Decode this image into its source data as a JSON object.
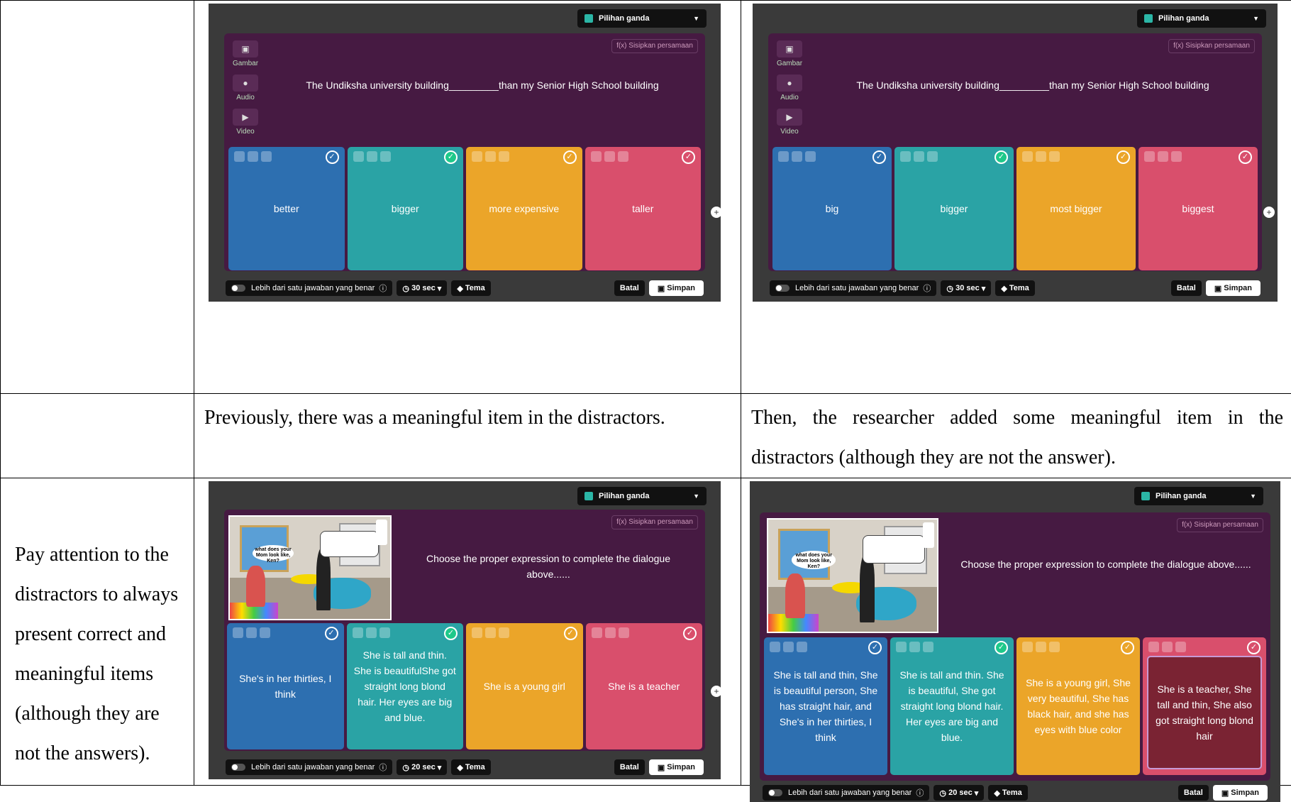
{
  "document": {
    "row2": {
      "left_text": "Previously, there was a meaningful item in the distractors.",
      "right_text": "Then, the researcher added some meaningful item in the distractors (although they are not the answer)."
    },
    "row3": {
      "label_text": "Pay attention to the distractors to always present correct and meaningful items (although they are not the answers)."
    }
  },
  "quiz_ui": {
    "type_selector": "Pilihan ganda",
    "equation_button": "f(x) Sisipkan persamaan",
    "media": [
      "Gambar",
      "Audio",
      "Video"
    ],
    "multiple_answers_toggle": "Lebih dari satu jawaban yang benar",
    "theme": "Tema",
    "cancel": "Batal",
    "save": "Simpan"
  },
  "screens": {
    "s1": {
      "question": "The Undiksha university building_________than my Senior High School building",
      "time": "30 sec",
      "options": [
        "better",
        "bigger",
        "more expensive",
        "taller"
      ],
      "correct_index": 1
    },
    "s2": {
      "question": "The Undiksha university building_________than my Senior High School building",
      "time": "30 sec",
      "options": [
        "big",
        "bigger",
        "most bigger",
        "biggest"
      ],
      "correct_index": 1
    },
    "s3": {
      "question": "Choose the proper expression to complete the dialogue above......",
      "bubble": "what does your Mom look like, Ken?",
      "time": "20 sec",
      "options": [
        "She's in her thirties, I think",
        "She is tall and thin. She is beautifulShe got straight long blond hair. Her eyes are big and blue.",
        "She is a young girl",
        "She is a teacher"
      ],
      "correct_index": 1
    },
    "s4": {
      "question": "Choose the proper expression to complete the dialogue above......",
      "bubble": "what does your Mom look like, Ken?",
      "time": "20 sec",
      "options": [
        "She is tall and thin, She is beautiful person, She has straight hair, and She's in her thirties, I think",
        "She is tall and thin. She is beautiful, She got straight long blond hair. Her eyes are big and blue.",
        "She is a young girl, She very beautiful, She has black hair, and she has eyes with blue color",
        "She is a teacher, She tall and thin, She also got straight long blond hair"
      ],
      "correct_index": 1
    }
  },
  "colors": {
    "option_blue": "#2d6fb0",
    "option_teal": "#2aa3a5",
    "option_yellow": "#eba529",
    "option_red": "#d94f6c",
    "question_panel": "#461a42",
    "editor_bg": "#3a3a3a"
  },
  "icons": [
    "image-icon",
    "mic-icon",
    "video-icon",
    "check-icon",
    "plus-icon",
    "toggle-icon",
    "timer-icon",
    "tag-icon",
    "save-icon",
    "chevron-down-icon"
  ]
}
